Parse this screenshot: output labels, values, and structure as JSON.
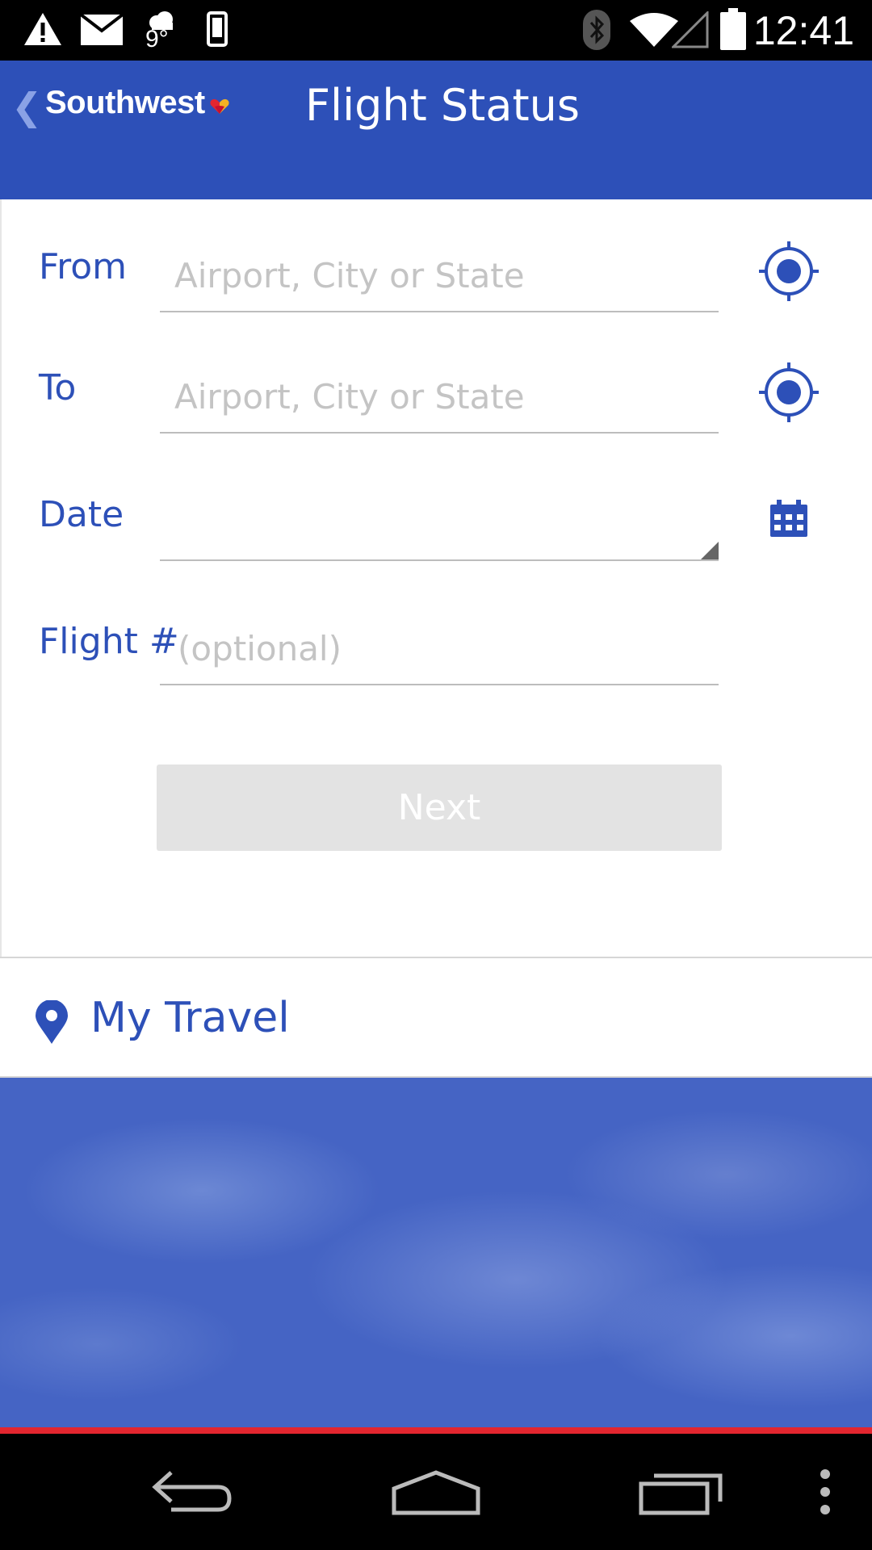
{
  "status_bar": {
    "time": "12:41",
    "temperature": "9°",
    "icons": [
      "warning-icon",
      "mail-icon",
      "weather-icon",
      "phone-icon",
      "bluetooth-icon",
      "wifi-icon",
      "signal-icon",
      "battery-icon"
    ]
  },
  "header": {
    "brand": "Southwest",
    "title": "Flight Status"
  },
  "form": {
    "from": {
      "label": "From",
      "placeholder": "Airport, City or State"
    },
    "to": {
      "label": "To",
      "placeholder": "Airport, City or State"
    },
    "date": {
      "label": "Date"
    },
    "flight": {
      "label": "Flight #",
      "placeholder": "(optional)"
    },
    "next_label": "Next"
  },
  "my_travel": {
    "label": "My Travel"
  },
  "colors": {
    "brand_blue": "#2d50b8",
    "accent_red": "#e3262f",
    "disabled_button": "#e3e3e3"
  }
}
